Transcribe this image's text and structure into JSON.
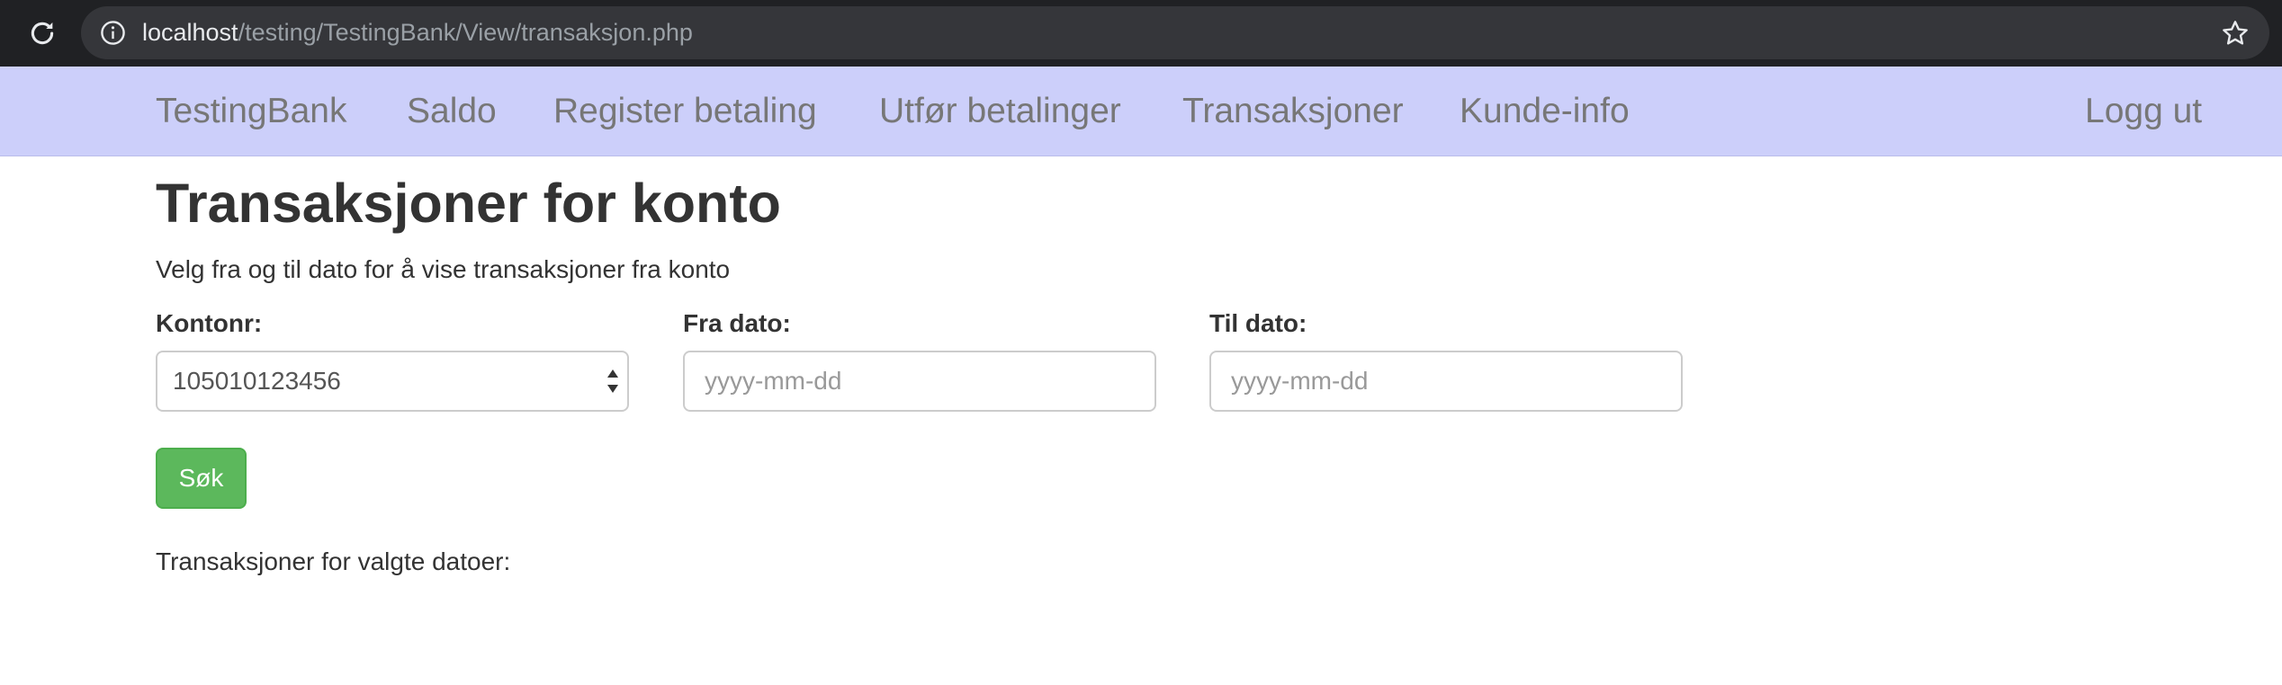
{
  "browser": {
    "url_host": "localhost",
    "url_path": "/testing/TestingBank/View/transaksjon.php",
    "icons": {
      "reload": "reload-icon",
      "info": "info-icon",
      "bookmark": "star-icon"
    }
  },
  "navbar": {
    "brand": "TestingBank",
    "items": [
      {
        "label": "Saldo"
      },
      {
        "label": "Register betaling"
      },
      {
        "label": "Utfør betalinger"
      },
      {
        "label": "Transaksjoner"
      },
      {
        "label": "Kunde-info"
      }
    ],
    "logout": "Logg ut",
    "background": "#cccffa"
  },
  "main": {
    "title": "Transaksjoner for konto",
    "intro": "Velg fra og til dato for å vise transaksjoner fra konto",
    "form": {
      "account_label": "Kontonr:",
      "account_value": "105010123456",
      "from_label": "Fra dato:",
      "from_placeholder": "yyyy-mm-dd",
      "to_label": "Til dato:",
      "to_placeholder": "yyyy-mm-dd",
      "submit_label": "Søk",
      "submit_color": "#5cb85c"
    },
    "results_label": "Transaksjoner for valgte datoer:"
  }
}
